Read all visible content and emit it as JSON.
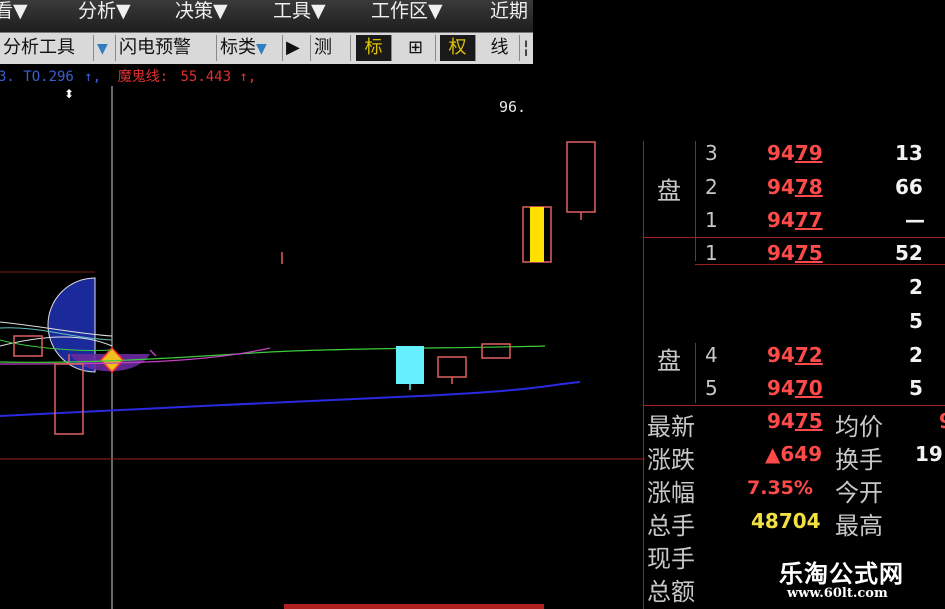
{
  "menu": [
    {
      "label": "看▼"
    },
    {
      "label": "分析▼"
    },
    {
      "label": "决策▼"
    },
    {
      "label": "工具▼"
    },
    {
      "label": "工作区▼"
    },
    {
      "label": "近期"
    }
  ],
  "toolbar": {
    "analysis_tools": "分析工具",
    "flash_alert": "闪电预警",
    "marker_type": "标类",
    "play": "▶",
    "measure": "测",
    "mark": "标",
    "grid": "⊞",
    "weight": "权",
    "line": "线",
    "more": "¦"
  },
  "indicator_line": {
    "prefix": "3. TO.296",
    "prefix_arrow": "↑,",
    "label": "魔鬼线:",
    "value": "55.443",
    "suffix": "↑,"
  },
  "chart": {
    "price_label": "96."
  },
  "order_book": {
    "ask_label": "盘",
    "bid_label": "盘",
    "asks": [
      {
        "level": "3",
        "price_main": "94",
        "price_tail": "79",
        "volume": "13"
      },
      {
        "level": "2",
        "price_main": "94",
        "price_tail": "78",
        "volume": "66"
      },
      {
        "level": "1",
        "price_main": "94",
        "price_tail": "77",
        "volume": "—"
      }
    ],
    "bids": [
      {
        "level": "1",
        "price_main": "94",
        "price_tail": "75",
        "volume": "52"
      },
      {
        "level": "",
        "price_main": "",
        "price_tail": "",
        "volume": "2"
      },
      {
        "level": "",
        "price_main": "",
        "price_tail": "",
        "volume": "5"
      },
      {
        "level": "4",
        "price_main": "94",
        "price_tail": "72",
        "volume": "2"
      },
      {
        "level": "5",
        "price_main": "94",
        "price_tail": "70",
        "volume": "5"
      }
    ]
  },
  "stats": {
    "latest_label": "最新",
    "latest_main": "94",
    "latest_tail": "75",
    "avg_label": "均价",
    "avg_value": "9",
    "change_label": "涨跌",
    "change_value": "▲649",
    "turnover_label": "换手",
    "turnover_value": "19",
    "pct_label": "涨幅",
    "pct_value": "7.35%",
    "open_label": "今开",
    "open_value": "",
    "total_label": "总手",
    "total_value": "48704",
    "high_label": "最高",
    "high_value": "",
    "current_label": "现手",
    "amount_label": "总额"
  },
  "watermark": {
    "title": "乐淘公式网",
    "url": "www.60lt.com"
  },
  "colors": {
    "bg": "#000000",
    "ask_price": "#ff4a4a",
    "grid_line": "#a02020",
    "candle_cyan": "#66f0ff",
    "candle_yellow": "#ffe000",
    "ma_blue": "#2a2ae0",
    "ma_green": "#3ccc3c",
    "ma_purple": "#c040c0"
  }
}
